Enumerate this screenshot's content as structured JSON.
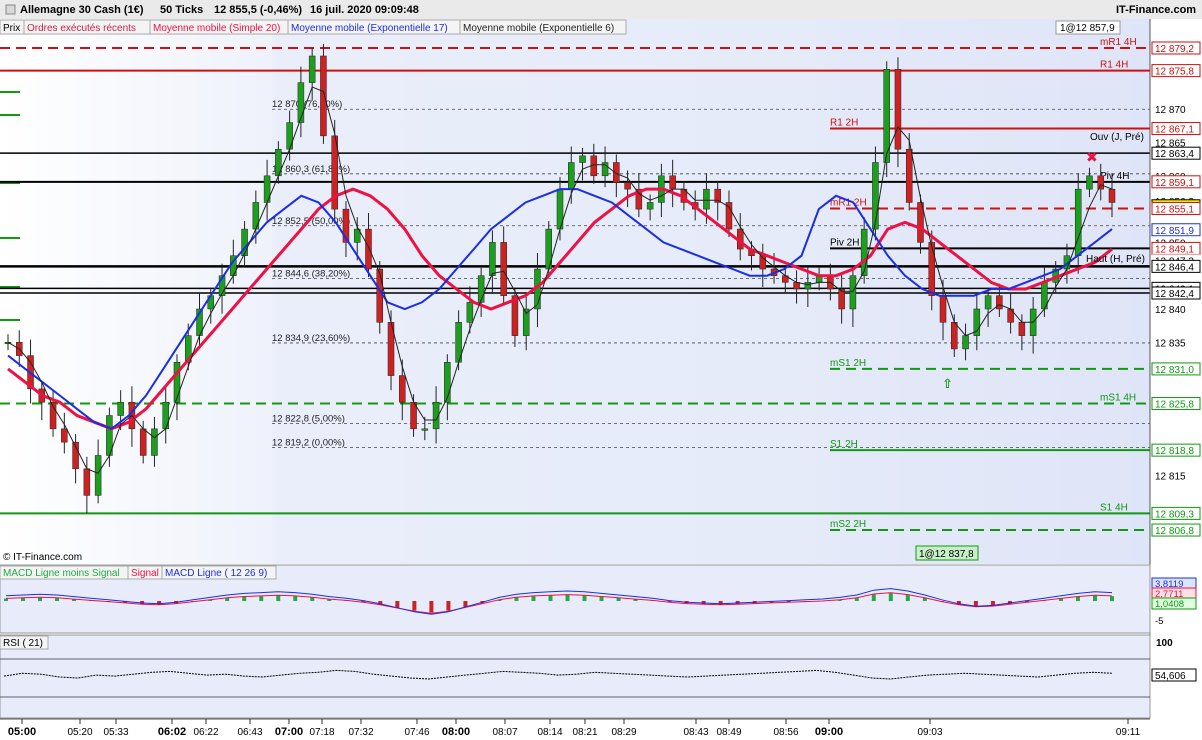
{
  "header": {
    "instrument": "Allemagne 30 Cash (1€)",
    "interval": "50 Ticks",
    "last_price": "12 855,5 (-0,46%)",
    "datetime": "16 juil. 2020 09:09:48",
    "brand": "IT-Finance.com"
  },
  "legend": {
    "prix": "Prix",
    "ordres": "Ordres exécutés récents",
    "ma20": "Moyenne mobile (Simple 20)",
    "ema17": "Moyenne mobile (Exponentielle 17)",
    "ema6": "Moyenne mobile (Exponentielle 6)"
  },
  "watermark": "© IT-Finance.com",
  "colors": {
    "up": "#1e9e1e",
    "down": "#cc2222",
    "ma20": "#ee1144",
    "ema17": "#1a2ee6",
    "ema6": "#222222",
    "bg": "#e8ecfa"
  },
  "chart_data": [
    {
      "type": "line",
      "title": "Allemagne 30 Cash (1€) 50 Ticks",
      "x_tick_labels": [
        "05:00",
        "05:20",
        "05:33",
        "06:02",
        "06:22",
        "06:43",
        "07:00",
        "07:18",
        "07:32",
        "07:46",
        "08:00",
        "08:07",
        "08:14",
        "08:21",
        "08:29",
        "08:43",
        "08:49",
        "08:56",
        "09:00",
        "09:03",
        "09:11"
      ],
      "bold_ticks": [
        "05:00",
        "06:02",
        "07:00",
        "08:00",
        "09:00"
      ],
      "y_tick_labels": [
        "12 870",
        "12 865",
        "12 860",
        "12 856,2",
        "12 851,9",
        "12 850",
        "12 847,3",
        "12 842,4",
        "12 840",
        "12 835",
        "12 830",
        "12 825",
        "12 820",
        "12 815",
        "12 810"
      ],
      "ylim": [
        12802,
        12881
      ],
      "close_series": [
        12835,
        12833,
        12828,
        12826,
        12822,
        12820,
        12816,
        12812,
        12818,
        12824,
        12826,
        12822,
        12818,
        12822,
        12826,
        12832,
        12836,
        12840,
        12842,
        12845,
        12848,
        12852,
        12856,
        12860,
        12864,
        12868,
        12874,
        12878,
        12866,
        12855,
        12850,
        12852,
        12846,
        12838,
        12830,
        12826,
        12822,
        12822,
        12826,
        12832,
        12838,
        12841,
        12845,
        12850,
        12842,
        12836,
        12840,
        12846,
        12852,
        12858,
        12862,
        12863,
        12860,
        12862,
        12859,
        12858,
        12855,
        12856,
        12860,
        12858,
        12856,
        12855,
        12858,
        12856,
        12852,
        12849,
        12848,
        12846,
        12845,
        12844,
        12843,
        12844,
        12845,
        12843,
        12840,
        12845,
        12852,
        12862,
        12876,
        12864,
        12856,
        12850,
        12842,
        12838,
        12834,
        12836,
        12840,
        12842,
        12840,
        12838,
        12836,
        12840,
        12844,
        12846,
        12848,
        12858,
        12860,
        12858,
        12856
      ],
      "series": [
        {
          "name": "Moyenne mobile (Simple 20)",
          "color": "#ee1144",
          "values": [
            12831,
            12829,
            12827,
            12826,
            12824,
            12823,
            12822,
            12823,
            12825,
            12828,
            12831,
            12834,
            12837,
            12840,
            12843,
            12846,
            12849,
            12852,
            12855,
            12857,
            12858,
            12857,
            12855,
            12852,
            12848,
            12845,
            12843,
            12841,
            12840,
            12841,
            12842,
            12844,
            12847,
            12850,
            12853,
            12855,
            12857,
            12858,
            12858,
            12857,
            12855,
            12853,
            12851,
            12849,
            12848,
            12847,
            12846,
            12845,
            12845,
            12846,
            12848,
            12852,
            12853,
            12852,
            12850,
            12848,
            12846,
            12844,
            12843,
            12843,
            12844,
            12845,
            12846,
            12847,
            12849
          ]
        },
        {
          "name": "Moyenne mobile (Exponentielle 17)",
          "color": "#1a2ee6",
          "values": [
            12833,
            12831,
            12829,
            12827,
            12825,
            12823,
            12822,
            12824,
            12827,
            12831,
            12835,
            12839,
            12843,
            12847,
            12850,
            12853,
            12855,
            12857,
            12856,
            12853,
            12849,
            12845,
            12841,
            12840,
            12841,
            12843,
            12846,
            12849,
            12852,
            12854,
            12856,
            12857,
            12858,
            12858,
            12857,
            12856,
            12854,
            12852,
            12850,
            12849,
            12848,
            12847,
            12846,
            12845,
            12845,
            12846,
            12848,
            12855,
            12857,
            12856,
            12852,
            12848,
            12845,
            12843,
            12842,
            12842,
            12842,
            12843,
            12843,
            12844,
            12845,
            12846,
            12848,
            12850,
            12852
          ]
        }
      ],
      "levels": [
        {
          "name": "mR1 4H",
          "value": 12879.2,
          "color": "#cc1111"
        },
        {
          "name": "R1 4H",
          "value": 12875.8,
          "color": "#cc1111"
        },
        {
          "name": "R1 2H",
          "value": 12867.1,
          "color": "#cc1111"
        },
        {
          "name": "Piv 4H",
          "value": 12859.1,
          "color": "#000000"
        },
        {
          "name": "mR1 2H",
          "value": 12855.1,
          "color": "#cc1111"
        },
        {
          "name": "Piv 2H",
          "value": 12849.1,
          "color": "#000000"
        },
        {
          "name": "mS1 2H",
          "value": 12831.0,
          "color": "#119911"
        },
        {
          "name": "mS1 4H",
          "value": 12825.8,
          "color": "#119911"
        },
        {
          "name": "S1 2H",
          "value": 12818.8,
          "color": "#119911"
        },
        {
          "name": "S1 4H",
          "value": 12809.3,
          "color": "#119911"
        },
        {
          "name": "mS2 2H",
          "value": 12806.8,
          "color": "#119911"
        }
      ],
      "fibonacci": [
        {
          "label": "12 870 (76,40%)",
          "value": 12870
        },
        {
          "label": "12 860,3 (61,80%)",
          "value": 12860.3
        },
        {
          "label": "12 852,5 (50,00%)",
          "value": 12852.5
        },
        {
          "label": "12 844,6 (38,20%)",
          "value": 12844.6
        },
        {
          "label": "12 834,9 (23,60%)",
          "value": 12834.9
        },
        {
          "label": "12 822,8 (5,00%)",
          "value": 12822.8
        },
        {
          "label": "12 819,2 (0,00%)",
          "value": 12819.2
        }
      ],
      "right_labels": [
        {
          "text": "12 879,2",
          "value": 12879.2,
          "style": "red"
        },
        {
          "text": "12 875,8",
          "value": 12875.8,
          "style": "red"
        },
        {
          "text": "12 870",
          "value": 12870,
          "style": "plain"
        },
        {
          "text": "12 867,1",
          "value": 12867.1,
          "style": "red"
        },
        {
          "text": "12 865",
          "value": 12865,
          "style": "plain"
        },
        {
          "text": "12 863,4",
          "value": 12863.4,
          "style": "black"
        },
        {
          "text": "12 860",
          "value": 12860,
          "style": "plain"
        },
        {
          "text": "12 859,1",
          "value": 12859.1,
          "style": "red"
        },
        {
          "text": "12 856,2",
          "value": 12856.2,
          "style": "plain"
        },
        {
          "text": "12 855,5",
          "value": 12855.5,
          "style": "price"
        },
        {
          "text": "12 855,1",
          "value": 12855.1,
          "style": "red"
        },
        {
          "text": "12 851,9",
          "value": 12851.9,
          "style": "blue"
        },
        {
          "text": "12 850",
          "value": 12850,
          "style": "plain"
        },
        {
          "text": "12 849,1",
          "value": 12849.1,
          "style": "red"
        },
        {
          "text": "12 847,3",
          "value": 12847.3,
          "style": "plain"
        },
        {
          "text": "12 846,4",
          "value": 12846.4,
          "style": "black"
        },
        {
          "text": "12 843,1",
          "value": 12843.1,
          "style": "black"
        },
        {
          "text": "12 842,4",
          "value": 12842.4,
          "style": "black"
        },
        {
          "text": "12 840",
          "value": 12840,
          "style": "plain"
        },
        {
          "text": "12 835",
          "value": 12835,
          "style": "plain"
        },
        {
          "text": "12 831,0",
          "value": 12831.0,
          "style": "green"
        },
        {
          "text": "12 825,8",
          "value": 12825.8,
          "style": "green"
        },
        {
          "text": "12 818,8",
          "value": 12818.8,
          "style": "green"
        },
        {
          "text": "12 815",
          "value": 12815,
          "style": "plain"
        },
        {
          "text": "12 809,3",
          "value": 12809.3,
          "style": "green"
        },
        {
          "text": "12 806,8",
          "value": 12806.8,
          "style": "green"
        }
      ],
      "annotations": [
        {
          "text": "1@12 857,9",
          "kind": "order-sell"
        },
        {
          "text": "1@12 837,8",
          "kind": "order-buy"
        },
        {
          "text": "Ouv (J, Pré)",
          "kind": "label"
        },
        {
          "text": "Haut (H, Pré)",
          "kind": "label"
        }
      ]
    },
    {
      "type": "bar",
      "title": "MACD Ligne ( 12 26 9)",
      "legend": [
        "MACD Ligne moins Signal",
        "Signal",
        "MACD Ligne ( 12 26 9)"
      ],
      "y_tick_labels": [
        "3,8119",
        "2,7711",
        "1,0408",
        "-5"
      ],
      "histogram": [
        0.8,
        1.0,
        1.2,
        1.0,
        0.6,
        0.2,
        -0.2,
        -0.6,
        -1.0,
        -1.2,
        -0.8,
        -0.2,
        0.4,
        1.0,
        1.4,
        1.6,
        1.8,
        1.6,
        1.2,
        0.6,
        0.2,
        -0.4,
        -1.2,
        -2.2,
        -3.2,
        -3.8,
        -3.2,
        -2.0,
        -0.8,
        0.4,
        1.2,
        1.6,
        1.8,
        2.0,
        1.8,
        1.4,
        1.0,
        0.6,
        0.2,
        -0.4,
        -0.8,
        -1.0,
        -1.2,
        -1.0,
        -0.8,
        -0.6,
        -0.4,
        -0.2,
        0.0,
        0.4,
        1.0,
        2.2,
        2.6,
        2.0,
        1.0,
        -0.2,
        -1.2,
        -1.8,
        -1.6,
        -1.0,
        -0.4,
        0.2,
        0.8,
        1.4,
        1.8,
        1.6
      ]
    },
    {
      "type": "line",
      "title": "RSI ( 21)",
      "y_tick_labels": [
        "100",
        "54,606"
      ],
      "values": [
        52,
        55,
        54,
        51,
        50,
        53,
        52,
        54,
        56,
        57,
        55,
        53,
        54,
        52,
        51,
        53,
        55,
        56,
        58,
        57,
        54,
        52,
        50,
        49,
        51,
        53,
        55,
        57,
        56,
        55,
        53,
        54,
        56,
        55,
        54,
        53,
        52,
        51,
        52,
        53,
        54,
        55,
        56,
        57,
        58,
        56,
        53,
        50,
        49,
        51,
        53,
        54,
        55,
        54,
        53,
        52,
        51,
        53,
        55,
        56,
        55
      ]
    }
  ]
}
